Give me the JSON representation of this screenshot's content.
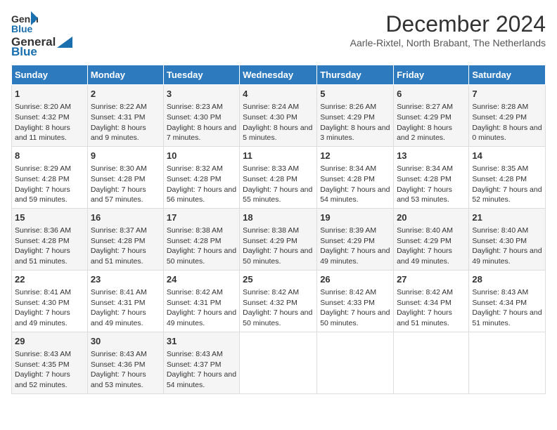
{
  "header": {
    "logo_general": "General",
    "logo_blue": "Blue",
    "title": "December 2024",
    "location": "Aarle-Rixtel, North Brabant, The Netherlands"
  },
  "columns": [
    "Sunday",
    "Monday",
    "Tuesday",
    "Wednesday",
    "Thursday",
    "Friday",
    "Saturday"
  ],
  "weeks": [
    [
      {
        "day": "1",
        "sunrise": "8:20 AM",
        "sunset": "4:32 PM",
        "daylight": "8 hours and 11 minutes."
      },
      {
        "day": "2",
        "sunrise": "8:22 AM",
        "sunset": "4:31 PM",
        "daylight": "8 hours and 9 minutes."
      },
      {
        "day": "3",
        "sunrise": "8:23 AM",
        "sunset": "4:30 PM",
        "daylight": "8 hours and 7 minutes."
      },
      {
        "day": "4",
        "sunrise": "8:24 AM",
        "sunset": "4:30 PM",
        "daylight": "8 hours and 5 minutes."
      },
      {
        "day": "5",
        "sunrise": "8:26 AM",
        "sunset": "4:29 PM",
        "daylight": "8 hours and 3 minutes."
      },
      {
        "day": "6",
        "sunrise": "8:27 AM",
        "sunset": "4:29 PM",
        "daylight": "8 hours and 2 minutes."
      },
      {
        "day": "7",
        "sunrise": "8:28 AM",
        "sunset": "4:29 PM",
        "daylight": "8 hours and 0 minutes."
      }
    ],
    [
      {
        "day": "8",
        "sunrise": "8:29 AM",
        "sunset": "4:28 PM",
        "daylight": "7 hours and 59 minutes."
      },
      {
        "day": "9",
        "sunrise": "8:30 AM",
        "sunset": "4:28 PM",
        "daylight": "7 hours and 57 minutes."
      },
      {
        "day": "10",
        "sunrise": "8:32 AM",
        "sunset": "4:28 PM",
        "daylight": "7 hours and 56 minutes."
      },
      {
        "day": "11",
        "sunrise": "8:33 AM",
        "sunset": "4:28 PM",
        "daylight": "7 hours and 55 minutes."
      },
      {
        "day": "12",
        "sunrise": "8:34 AM",
        "sunset": "4:28 PM",
        "daylight": "7 hours and 54 minutes."
      },
      {
        "day": "13",
        "sunrise": "8:34 AM",
        "sunset": "4:28 PM",
        "daylight": "7 hours and 53 minutes."
      },
      {
        "day": "14",
        "sunrise": "8:35 AM",
        "sunset": "4:28 PM",
        "daylight": "7 hours and 52 minutes."
      }
    ],
    [
      {
        "day": "15",
        "sunrise": "8:36 AM",
        "sunset": "4:28 PM",
        "daylight": "7 hours and 51 minutes."
      },
      {
        "day": "16",
        "sunrise": "8:37 AM",
        "sunset": "4:28 PM",
        "daylight": "7 hours and 51 minutes."
      },
      {
        "day": "17",
        "sunrise": "8:38 AM",
        "sunset": "4:28 PM",
        "daylight": "7 hours and 50 minutes."
      },
      {
        "day": "18",
        "sunrise": "8:38 AM",
        "sunset": "4:29 PM",
        "daylight": "7 hours and 50 minutes."
      },
      {
        "day": "19",
        "sunrise": "8:39 AM",
        "sunset": "4:29 PM",
        "daylight": "7 hours and 49 minutes."
      },
      {
        "day": "20",
        "sunrise": "8:40 AM",
        "sunset": "4:29 PM",
        "daylight": "7 hours and 49 minutes."
      },
      {
        "day": "21",
        "sunrise": "8:40 AM",
        "sunset": "4:30 PM",
        "daylight": "7 hours and 49 minutes."
      }
    ],
    [
      {
        "day": "22",
        "sunrise": "8:41 AM",
        "sunset": "4:30 PM",
        "daylight": "7 hours and 49 minutes."
      },
      {
        "day": "23",
        "sunrise": "8:41 AM",
        "sunset": "4:31 PM",
        "daylight": "7 hours and 49 minutes."
      },
      {
        "day": "24",
        "sunrise": "8:42 AM",
        "sunset": "4:31 PM",
        "daylight": "7 hours and 49 minutes."
      },
      {
        "day": "25",
        "sunrise": "8:42 AM",
        "sunset": "4:32 PM",
        "daylight": "7 hours and 50 minutes."
      },
      {
        "day": "26",
        "sunrise": "8:42 AM",
        "sunset": "4:33 PM",
        "daylight": "7 hours and 50 minutes."
      },
      {
        "day": "27",
        "sunrise": "8:42 AM",
        "sunset": "4:34 PM",
        "daylight": "7 hours and 51 minutes."
      },
      {
        "day": "28",
        "sunrise": "8:43 AM",
        "sunset": "4:34 PM",
        "daylight": "7 hours and 51 minutes."
      }
    ],
    [
      {
        "day": "29",
        "sunrise": "8:43 AM",
        "sunset": "4:35 PM",
        "daylight": "7 hours and 52 minutes."
      },
      {
        "day": "30",
        "sunrise": "8:43 AM",
        "sunset": "4:36 PM",
        "daylight": "7 hours and 53 minutes."
      },
      {
        "day": "31",
        "sunrise": "8:43 AM",
        "sunset": "4:37 PM",
        "daylight": "7 hours and 54 minutes."
      },
      null,
      null,
      null,
      null
    ]
  ]
}
